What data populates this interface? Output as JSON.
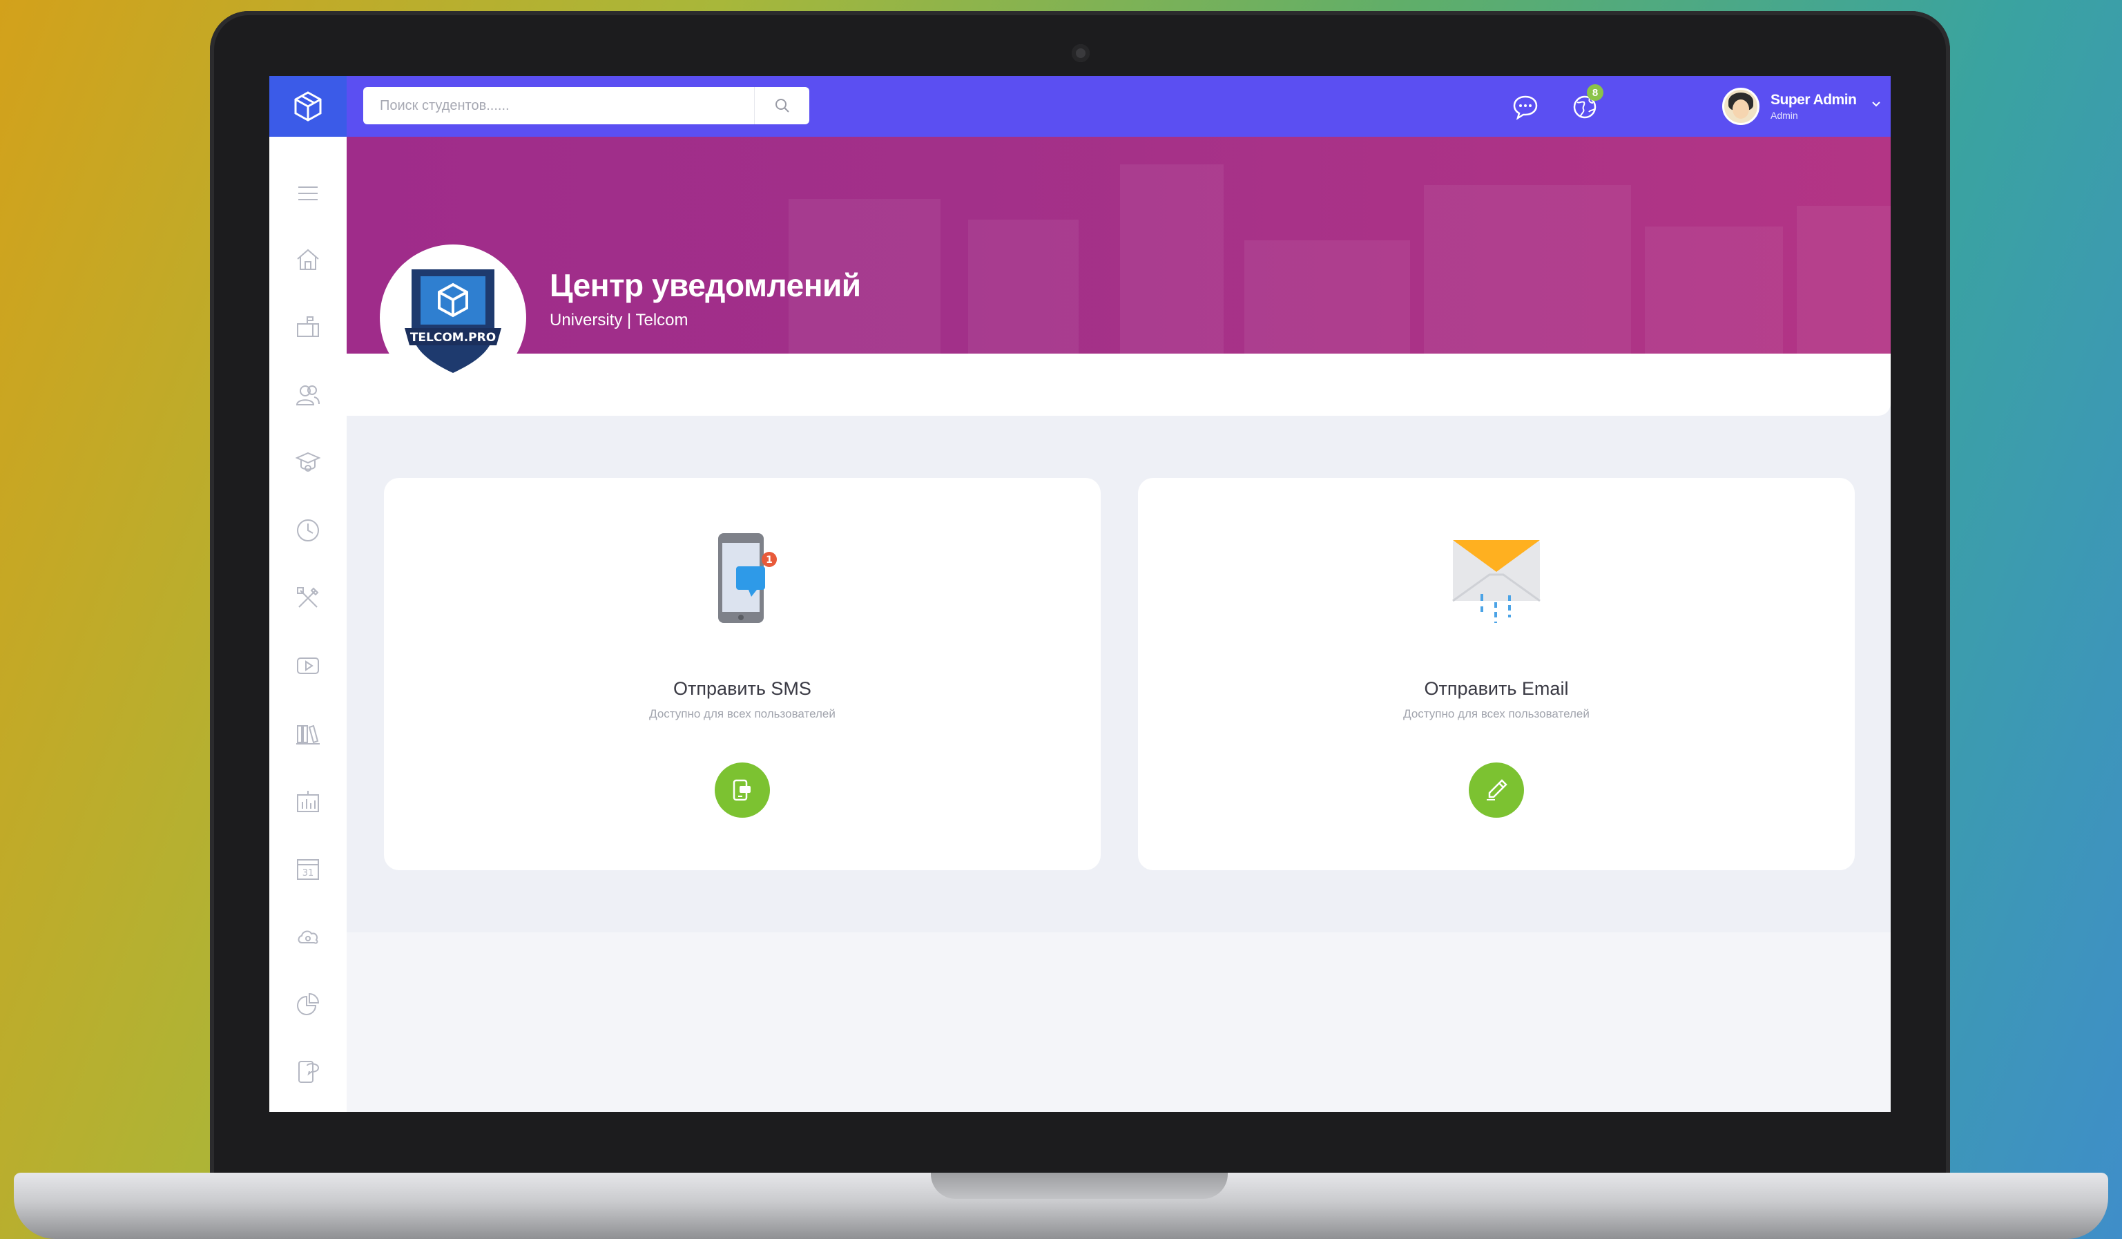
{
  "search": {
    "placeholder": "Поиск студентов......"
  },
  "header": {
    "notifications_badge": "8",
    "user_name": "Super Admin",
    "user_role": "Admin"
  },
  "banner": {
    "title": "Центр уведомлений",
    "subtitle": "University | Telcom",
    "emblem_text": "TELCOM.PRO"
  },
  "cards": [
    {
      "title": "Отправить SMS",
      "subtitle": "Доступно для всех пользователей",
      "icon": "phone-notification-icon",
      "phone_badge": "1",
      "button_icon": "sms-send-icon"
    },
    {
      "title": "Отправить Email",
      "subtitle": "Доступно для всех пользователей",
      "icon": "envelope-icon",
      "button_icon": "pencil-icon"
    }
  ],
  "sidebar": {
    "items": [
      "menu-icon",
      "home-icon",
      "mailbox-icon",
      "users-icon",
      "graduation-cap-icon",
      "clock-icon",
      "tools-icon",
      "video-icon",
      "library-icon",
      "stats-icon",
      "calendar-icon",
      "cloud-icon",
      "pie-chart-icon",
      "feedback-icon"
    ],
    "calendar_day": "31"
  },
  "colors": {
    "topbar": "#5b4ff2",
    "logo_cell": "#3b5be8",
    "banner": "#a23089",
    "action_button": "#7cc231",
    "badge": "#8bc34a"
  }
}
